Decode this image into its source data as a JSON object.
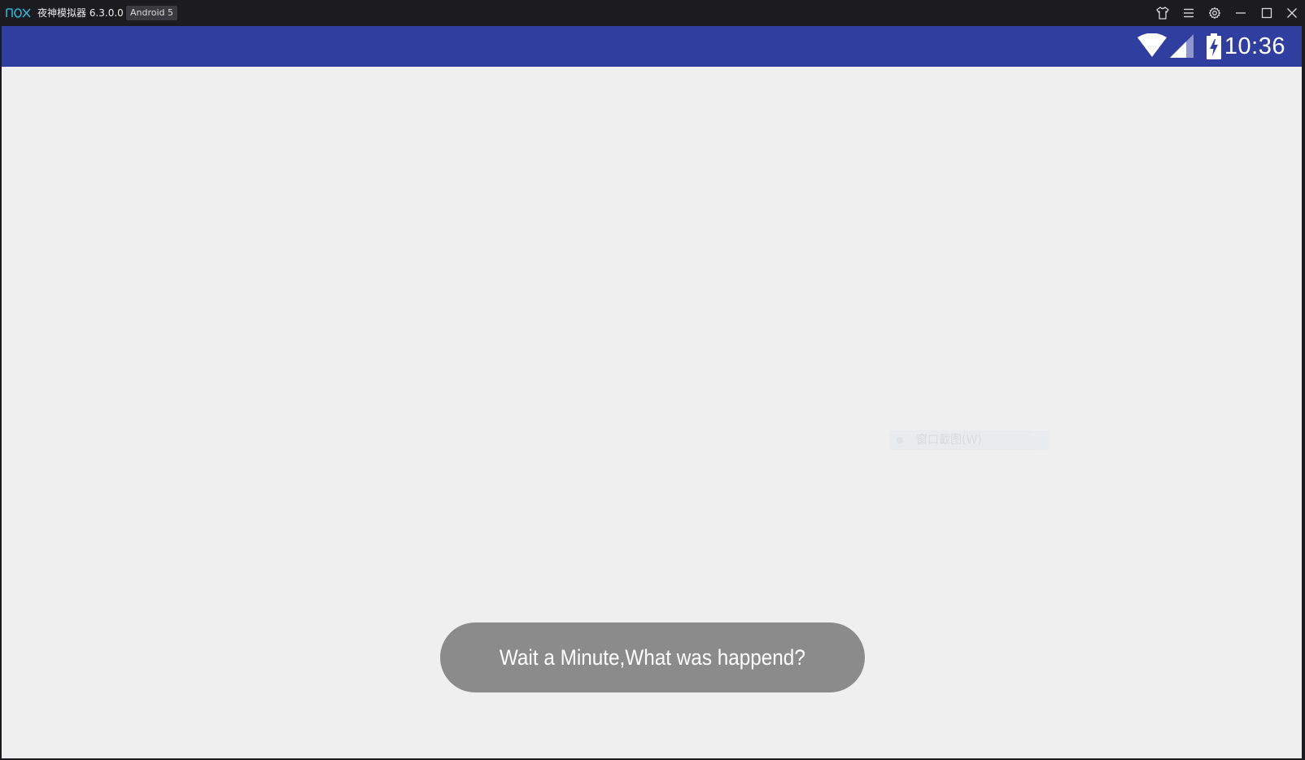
{
  "titlebar": {
    "app_title": "夜神模拟器 6.3.0.0",
    "version_badge": "Android 5",
    "logo_icon": "nox-logo",
    "buttons": [
      {
        "name": "skin-shirt-icon"
      },
      {
        "name": "menu-icon"
      },
      {
        "name": "settings-gear-icon"
      },
      {
        "name": "minimize-icon"
      },
      {
        "name": "maximize-icon"
      },
      {
        "name": "close-icon"
      }
    ]
  },
  "statusbar": {
    "background": "#303f9f",
    "wifi_icon": "wifi-icon",
    "signal_icon": "cell-signal-icon",
    "battery_icon": "battery-charging-icon",
    "time": "10:36"
  },
  "ghost_menu": {
    "label": "窗口截图(W)"
  },
  "toast": {
    "message": "Wait a Minute,What was happend?",
    "background": "#8b8b8b"
  }
}
